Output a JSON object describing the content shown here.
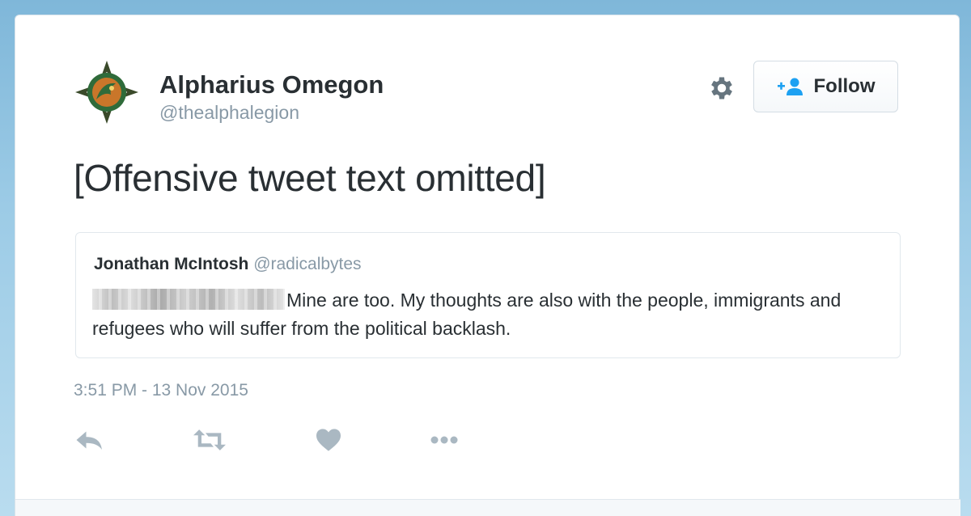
{
  "tweet": {
    "author_name": "Alpharius Omegon",
    "author_handle": "@thealphalegion",
    "text": "[Offensive tweet text omitted]",
    "timestamp": "3:51 PM - 13 Nov 2015"
  },
  "follow_button": {
    "label": "Follow"
  },
  "quoted_tweet": {
    "author_name": "Jonathan McIntosh",
    "author_handle": "@radicalbytes",
    "text": "Mine are too. My thoughts are also with the people, immigrants and refugees who will suffer from the political backlash."
  },
  "icons": {
    "settings": "gear-icon",
    "follow": "add-user-icon",
    "reply": "reply-icon",
    "retweet": "retweet-icon",
    "like": "heart-icon",
    "more": "more-icon"
  },
  "colors": {
    "accent": "#1da1f2",
    "text": "#292f33",
    "muted": "#8899a6",
    "icon": "#aab8c2",
    "background": "#9ccbe6"
  }
}
